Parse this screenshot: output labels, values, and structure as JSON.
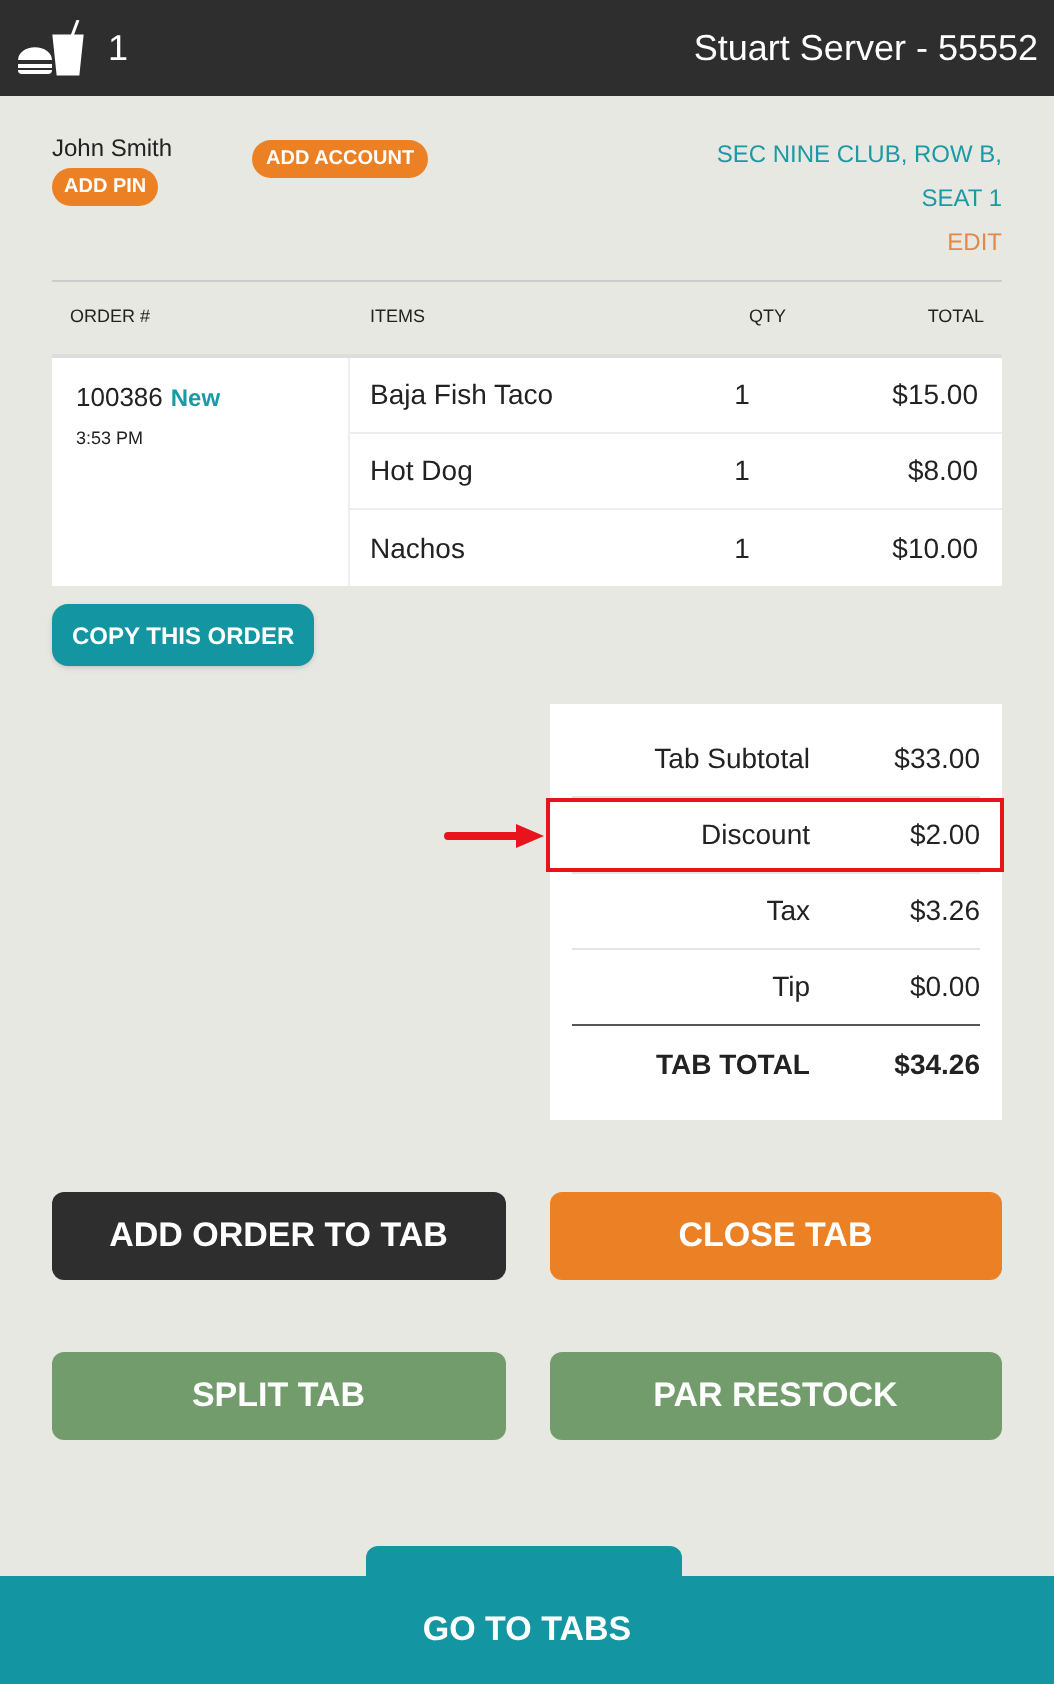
{
  "header": {
    "count": "1",
    "server": "Stuart Server - 55552"
  },
  "customer": {
    "name": "John Smith",
    "add_pin": "ADD PIN",
    "add_account": "ADD ACCOUNT",
    "location_lines": [
      "SEC NINE CLUB, ROW B,",
      "SEAT 1"
    ],
    "edit": "EDIT"
  },
  "table": {
    "columns": [
      "ORDER #",
      "ITEMS",
      "QTY",
      "TOTAL"
    ],
    "order": {
      "number": "100386",
      "status": "New",
      "time": "3:53 PM"
    },
    "rows": [
      {
        "item": "Baja Fish Taco",
        "qty": "1",
        "total": "$15.00"
      },
      {
        "item": "Hot Dog",
        "qty": "1",
        "total": "$8.00"
      },
      {
        "item": "Nachos",
        "qty": "1",
        "total": "$10.00"
      }
    ]
  },
  "copy_button": "COPY THIS ORDER",
  "summary": [
    {
      "label": "Tab Subtotal",
      "value": "$33.00",
      "highlighted": false,
      "kind": "line"
    },
    {
      "label": "Discount",
      "value": "$2.00",
      "highlighted": true,
      "kind": "line"
    },
    {
      "label": "Tax",
      "value": "$3.26",
      "highlighted": false,
      "kind": "line"
    },
    {
      "label": "Tip",
      "value": "$0.00",
      "highlighted": false,
      "kind": "line"
    },
    {
      "label": "TAB TOTAL",
      "value": "$34.26",
      "highlighted": false,
      "kind": "total"
    }
  ],
  "actions": [
    {
      "label": "ADD ORDER TO TAB",
      "kind": "dark"
    },
    {
      "label": "CLOSE TAB",
      "kind": "orange"
    },
    {
      "label": "SPLIT TAB",
      "kind": "green"
    },
    {
      "label": "PAR RESTOCK",
      "kind": "green"
    }
  ],
  "footer": {
    "label": "GO TO TABS"
  }
}
